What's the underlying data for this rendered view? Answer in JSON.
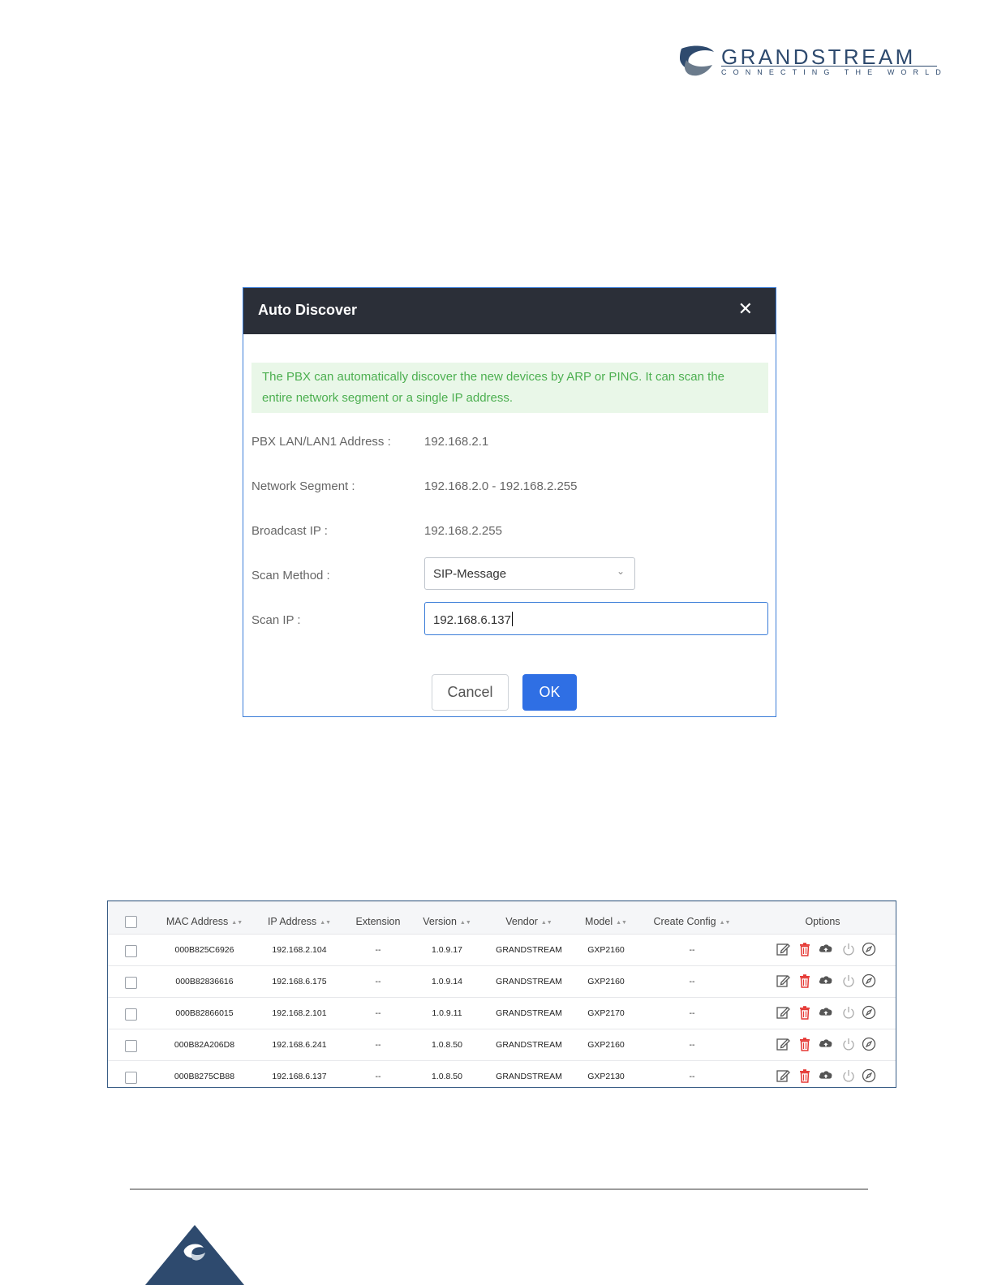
{
  "brand": {
    "name": "GRANDSTREAM",
    "tagline": "CONNECTING THE WORLD",
    "colors": {
      "primary": "#2e4a6e",
      "accent": "#5b6b7d"
    }
  },
  "dialog": {
    "title": "Auto Discover",
    "close_icon": "close-icon",
    "notice": "The PBX can automatically discover the new devices by ARP or PING. It can scan the entire network segment or a single IP address.",
    "fields": {
      "lan_label": "PBX LAN/LAN1 Address :",
      "lan_value": "192.168.2.1",
      "segment_label": "Network Segment :",
      "segment_value": "192.168.2.0 - 192.168.2.255",
      "broadcast_label": "Broadcast IP :",
      "broadcast_value": "192.168.2.255",
      "method_label": "Scan Method :",
      "method_value": "SIP-Message",
      "scanip_label": "Scan IP :",
      "scanip_value": "192.168.6.137"
    },
    "buttons": {
      "cancel": "Cancel",
      "ok": "OK"
    },
    "colors": {
      "header": "#2b2f38",
      "ok": "#2f6fe4",
      "notice_bg": "#e9f7e8",
      "notice_text": "#4caf50"
    }
  },
  "table": {
    "columns": [
      "MAC Address",
      "IP Address",
      "Extension",
      "Version",
      "Vendor",
      "Model",
      "Create Config",
      "Options"
    ],
    "sortable": [
      true,
      true,
      false,
      true,
      true,
      true,
      true,
      false
    ],
    "rows": [
      {
        "mac": "000B825C6926",
        "ip": "192.168.2.104",
        "ext": "--",
        "version": "1.0.9.17",
        "vendor": "GRANDSTREAM",
        "model": "GXP2160",
        "config": "--"
      },
      {
        "mac": "000B82836616",
        "ip": "192.168.6.175",
        "ext": "--",
        "version": "1.0.9.14",
        "vendor": "GRANDSTREAM",
        "model": "GXP2160",
        "config": "--"
      },
      {
        "mac": "000B82866015",
        "ip": "192.168.2.101",
        "ext": "--",
        "version": "1.0.9.11",
        "vendor": "GRANDSTREAM",
        "model": "GXP2170",
        "config": "--"
      },
      {
        "mac": "000B82A206D8",
        "ip": "192.168.6.241",
        "ext": "--",
        "version": "1.0.8.50",
        "vendor": "GRANDSTREAM",
        "model": "GXP2160",
        "config": "--"
      },
      {
        "mac": "000B8275CB88",
        "ip": "192.168.6.137",
        "ext": "--",
        "version": "1.0.8.50",
        "vendor": "GRANDSTREAM",
        "model": "GXP2130",
        "config": "--"
      }
    ],
    "option_icons": [
      "edit-icon",
      "delete-icon",
      "cloud-upload-icon",
      "power-icon",
      "compass-icon"
    ],
    "colors": {
      "delete": "#e53935",
      "border": "#3a5e86"
    }
  }
}
